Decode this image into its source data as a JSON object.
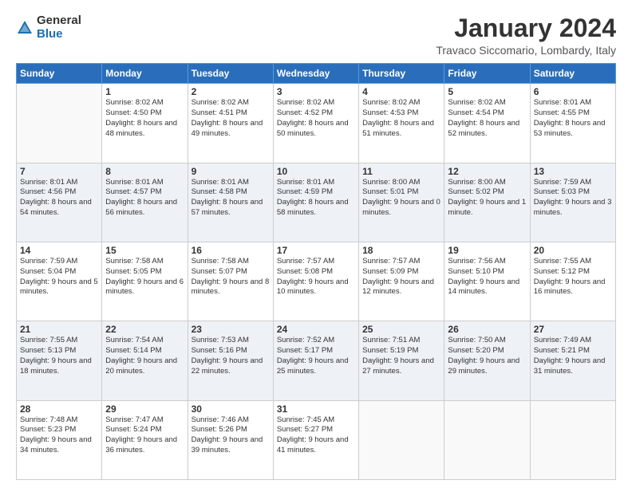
{
  "header": {
    "logo": {
      "general": "General",
      "blue": "Blue"
    },
    "title": "January 2024",
    "subtitle": "Travaco Siccomario, Lombardy, Italy"
  },
  "weekdays": [
    "Sunday",
    "Monday",
    "Tuesday",
    "Wednesday",
    "Thursday",
    "Friday",
    "Saturday"
  ],
  "weeks": [
    [
      {
        "day": "",
        "sunrise": "",
        "sunset": "",
        "daylight": ""
      },
      {
        "day": "1",
        "sunrise": "Sunrise: 8:02 AM",
        "sunset": "Sunset: 4:50 PM",
        "daylight": "Daylight: 8 hours and 48 minutes."
      },
      {
        "day": "2",
        "sunrise": "Sunrise: 8:02 AM",
        "sunset": "Sunset: 4:51 PM",
        "daylight": "Daylight: 8 hours and 49 minutes."
      },
      {
        "day": "3",
        "sunrise": "Sunrise: 8:02 AM",
        "sunset": "Sunset: 4:52 PM",
        "daylight": "Daylight: 8 hours and 50 minutes."
      },
      {
        "day": "4",
        "sunrise": "Sunrise: 8:02 AM",
        "sunset": "Sunset: 4:53 PM",
        "daylight": "Daylight: 8 hours and 51 minutes."
      },
      {
        "day": "5",
        "sunrise": "Sunrise: 8:02 AM",
        "sunset": "Sunset: 4:54 PM",
        "daylight": "Daylight: 8 hours and 52 minutes."
      },
      {
        "day": "6",
        "sunrise": "Sunrise: 8:01 AM",
        "sunset": "Sunset: 4:55 PM",
        "daylight": "Daylight: 8 hours and 53 minutes."
      }
    ],
    [
      {
        "day": "7",
        "sunrise": "Sunrise: 8:01 AM",
        "sunset": "Sunset: 4:56 PM",
        "daylight": "Daylight: 8 hours and 54 minutes."
      },
      {
        "day": "8",
        "sunrise": "Sunrise: 8:01 AM",
        "sunset": "Sunset: 4:57 PM",
        "daylight": "Daylight: 8 hours and 56 minutes."
      },
      {
        "day": "9",
        "sunrise": "Sunrise: 8:01 AM",
        "sunset": "Sunset: 4:58 PM",
        "daylight": "Daylight: 8 hours and 57 minutes."
      },
      {
        "day": "10",
        "sunrise": "Sunrise: 8:01 AM",
        "sunset": "Sunset: 4:59 PM",
        "daylight": "Daylight: 8 hours and 58 minutes."
      },
      {
        "day": "11",
        "sunrise": "Sunrise: 8:00 AM",
        "sunset": "Sunset: 5:01 PM",
        "daylight": "Daylight: 9 hours and 0 minutes."
      },
      {
        "day": "12",
        "sunrise": "Sunrise: 8:00 AM",
        "sunset": "Sunset: 5:02 PM",
        "daylight": "Daylight: 9 hours and 1 minute."
      },
      {
        "day": "13",
        "sunrise": "Sunrise: 7:59 AM",
        "sunset": "Sunset: 5:03 PM",
        "daylight": "Daylight: 9 hours and 3 minutes."
      }
    ],
    [
      {
        "day": "14",
        "sunrise": "Sunrise: 7:59 AM",
        "sunset": "Sunset: 5:04 PM",
        "daylight": "Daylight: 9 hours and 5 minutes."
      },
      {
        "day": "15",
        "sunrise": "Sunrise: 7:58 AM",
        "sunset": "Sunset: 5:05 PM",
        "daylight": "Daylight: 9 hours and 6 minutes."
      },
      {
        "day": "16",
        "sunrise": "Sunrise: 7:58 AM",
        "sunset": "Sunset: 5:07 PM",
        "daylight": "Daylight: 9 hours and 8 minutes."
      },
      {
        "day": "17",
        "sunrise": "Sunrise: 7:57 AM",
        "sunset": "Sunset: 5:08 PM",
        "daylight": "Daylight: 9 hours and 10 minutes."
      },
      {
        "day": "18",
        "sunrise": "Sunrise: 7:57 AM",
        "sunset": "Sunset: 5:09 PM",
        "daylight": "Daylight: 9 hours and 12 minutes."
      },
      {
        "day": "19",
        "sunrise": "Sunrise: 7:56 AM",
        "sunset": "Sunset: 5:10 PM",
        "daylight": "Daylight: 9 hours and 14 minutes."
      },
      {
        "day": "20",
        "sunrise": "Sunrise: 7:55 AM",
        "sunset": "Sunset: 5:12 PM",
        "daylight": "Daylight: 9 hours and 16 minutes."
      }
    ],
    [
      {
        "day": "21",
        "sunrise": "Sunrise: 7:55 AM",
        "sunset": "Sunset: 5:13 PM",
        "daylight": "Daylight: 9 hours and 18 minutes."
      },
      {
        "day": "22",
        "sunrise": "Sunrise: 7:54 AM",
        "sunset": "Sunset: 5:14 PM",
        "daylight": "Daylight: 9 hours and 20 minutes."
      },
      {
        "day": "23",
        "sunrise": "Sunrise: 7:53 AM",
        "sunset": "Sunset: 5:16 PM",
        "daylight": "Daylight: 9 hours and 22 minutes."
      },
      {
        "day": "24",
        "sunrise": "Sunrise: 7:52 AM",
        "sunset": "Sunset: 5:17 PM",
        "daylight": "Daylight: 9 hours and 25 minutes."
      },
      {
        "day": "25",
        "sunrise": "Sunrise: 7:51 AM",
        "sunset": "Sunset: 5:19 PM",
        "daylight": "Daylight: 9 hours and 27 minutes."
      },
      {
        "day": "26",
        "sunrise": "Sunrise: 7:50 AM",
        "sunset": "Sunset: 5:20 PM",
        "daylight": "Daylight: 9 hours and 29 minutes."
      },
      {
        "day": "27",
        "sunrise": "Sunrise: 7:49 AM",
        "sunset": "Sunset: 5:21 PM",
        "daylight": "Daylight: 9 hours and 31 minutes."
      }
    ],
    [
      {
        "day": "28",
        "sunrise": "Sunrise: 7:48 AM",
        "sunset": "Sunset: 5:23 PM",
        "daylight": "Daylight: 9 hours and 34 minutes."
      },
      {
        "day": "29",
        "sunrise": "Sunrise: 7:47 AM",
        "sunset": "Sunset: 5:24 PM",
        "daylight": "Daylight: 9 hours and 36 minutes."
      },
      {
        "day": "30",
        "sunrise": "Sunrise: 7:46 AM",
        "sunset": "Sunset: 5:26 PM",
        "daylight": "Daylight: 9 hours and 39 minutes."
      },
      {
        "day": "31",
        "sunrise": "Sunrise: 7:45 AM",
        "sunset": "Sunset: 5:27 PM",
        "daylight": "Daylight: 9 hours and 41 minutes."
      },
      {
        "day": "",
        "sunrise": "",
        "sunset": "",
        "daylight": ""
      },
      {
        "day": "",
        "sunrise": "",
        "sunset": "",
        "daylight": ""
      },
      {
        "day": "",
        "sunrise": "",
        "sunset": "",
        "daylight": ""
      }
    ]
  ]
}
